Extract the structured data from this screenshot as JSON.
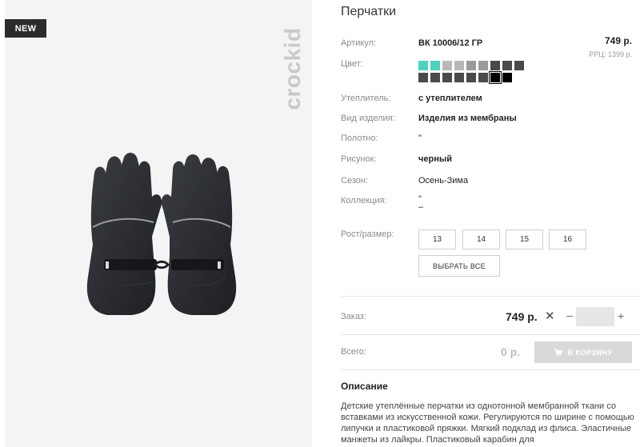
{
  "badge": "NEW",
  "brand": "crockid",
  "product": {
    "title": "Перчатки",
    "price": "749 р.",
    "rrp": "РРЦ: 1399 р."
  },
  "attributes": [
    {
      "label": "Артикул:",
      "value": "ВК 10006/12 ГР",
      "bold": true
    },
    {
      "label": "Цвет:",
      "value": "",
      "bold": false
    },
    {
      "label": "Утеплитель:",
      "value": "с утеплителем",
      "bold": true
    },
    {
      "label": "Вид изделия:",
      "value": "Изделия из мембраны",
      "bold": true
    },
    {
      "label": "Полотно:",
      "value": "\"",
      "bold": false
    },
    {
      "label": "Рисунок:",
      "value": "черный",
      "bold": true
    },
    {
      "label": "Сезон:",
      "value": "Осень-Зима",
      "bold": false
    },
    {
      "label": "Коллекция:",
      "value": "\"",
      "bold": false
    },
    {
      "label": "Рост/размер:",
      "value": "",
      "bold": false
    }
  ],
  "collection_extra": "–",
  "swatches": {
    "row1": [
      "#4fd2c0",
      "#4fd2c0",
      "#b8b8b8",
      "#b8b8b8",
      "#9a9a9a",
      "#9a9a9a",
      "#4a4a4a",
      "#4a4a4a",
      "#4a4a4a"
    ],
    "row2": [
      "#4a4a4a",
      "#4a4a4a",
      "#4a4a4a",
      "#4a4a4a",
      "#4a4a4a",
      "#4a4a4a",
      "#000000",
      "#000000"
    ],
    "selected_index_row2": 6
  },
  "sizes": [
    "13",
    "14",
    "15",
    "16"
  ],
  "select_all": "ВЫБРАТЬ ВСЕ",
  "order": {
    "label": "Заказ:",
    "price": "749 р.",
    "times": "✕",
    "minus": "–",
    "plus": "+",
    "quantity": ""
  },
  "total": {
    "label": "Всего:",
    "value": "0 р.",
    "cart_button": "В КОРЗИНУ"
  },
  "description": {
    "title": "Описание",
    "text": "Детские утеплённые перчатки из однотонной мембранной ткани со вставками из искусственной кожи. Регулируются по ширине с помощью липучки и пластиковой пряжки. Мягкий подклад из флиса. Эластичные манжеты из лайкры. Пластиковый карабин для"
  },
  "colors": {
    "badge_bg": "#2b2b2b",
    "swatch_accent": "#4fd2c0",
    "cart_button_bg": "#d9d9d9"
  }
}
